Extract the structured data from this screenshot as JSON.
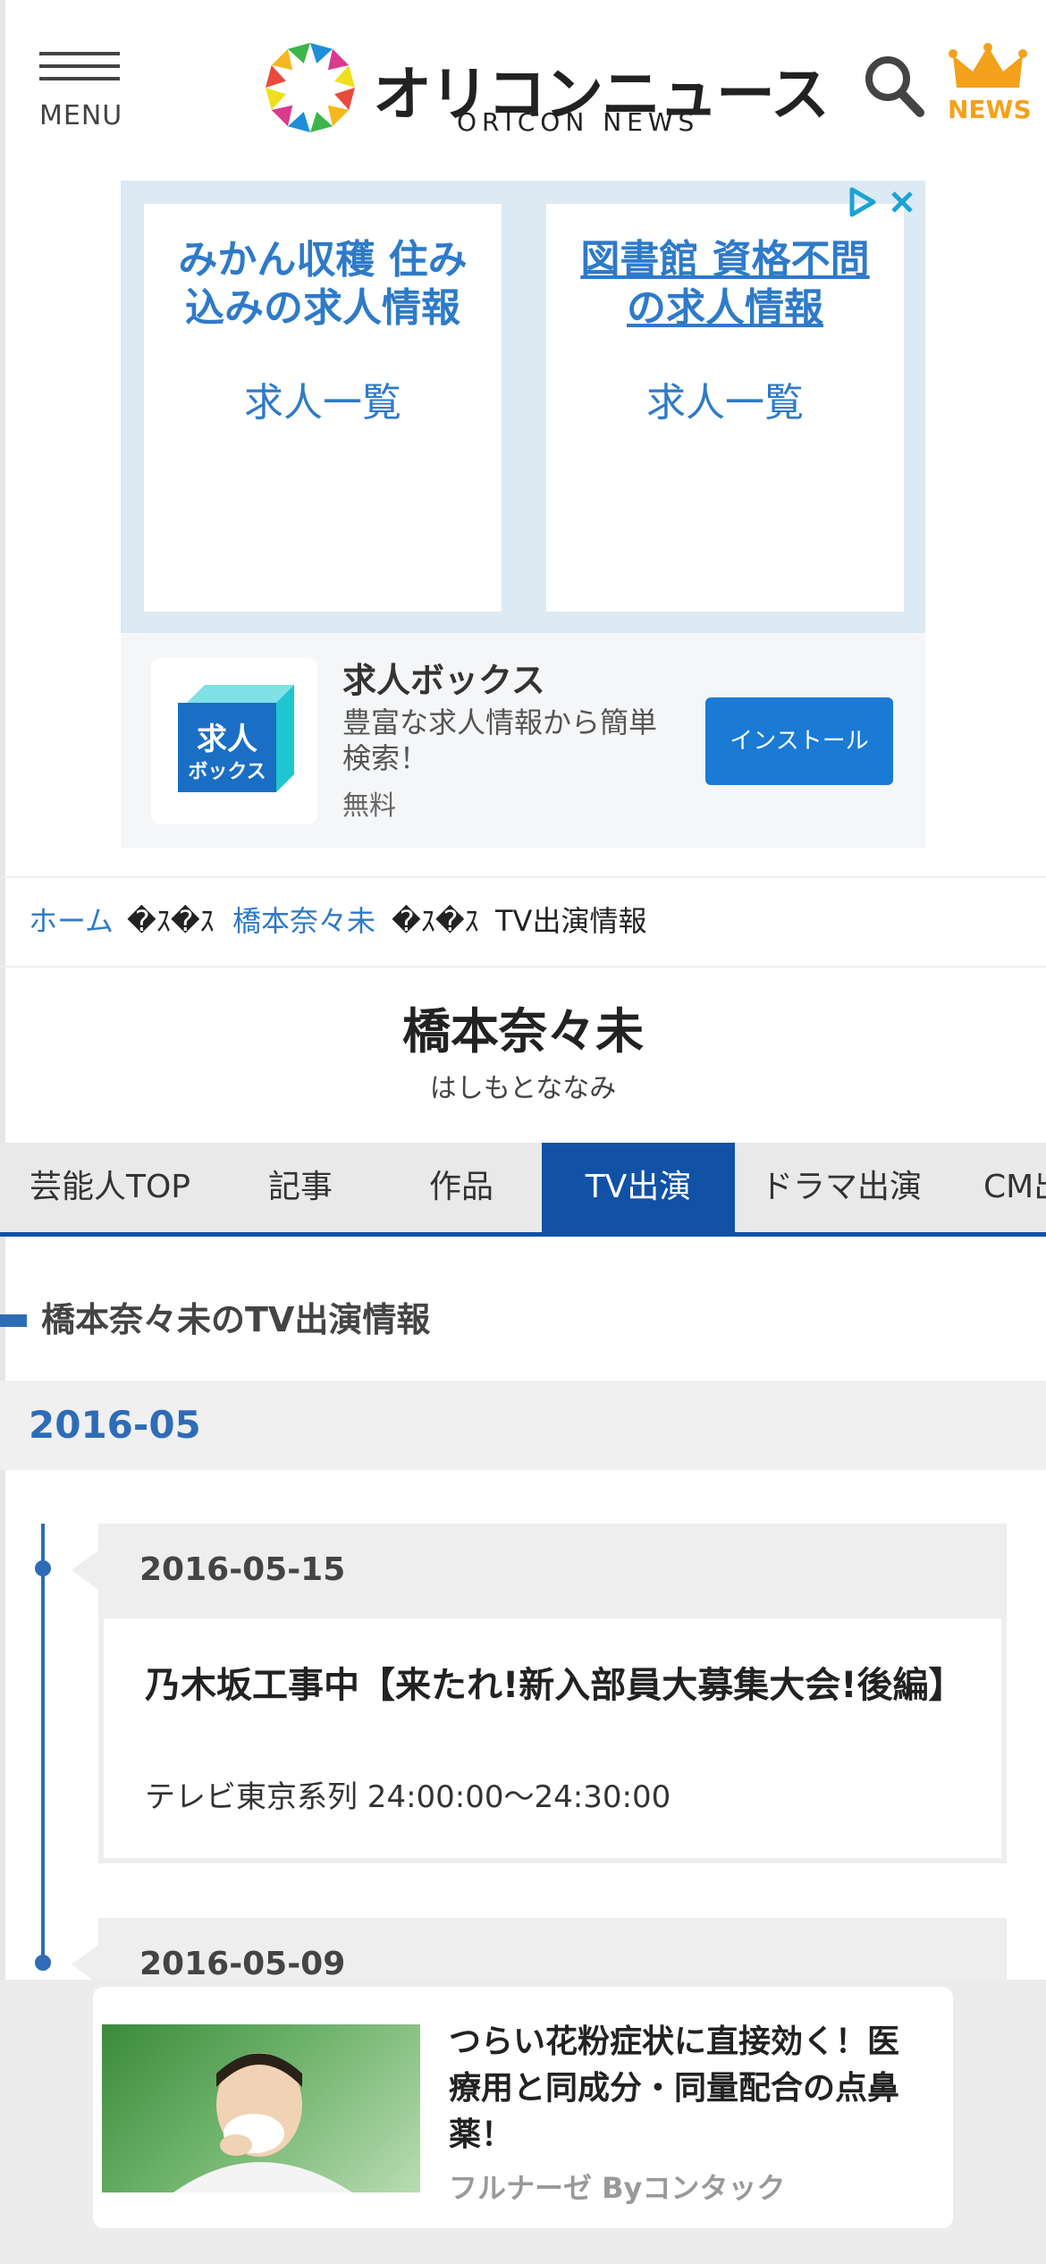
{
  "header": {
    "menu_label": "MENU",
    "logo_jp": "オリコンニュース",
    "logo_en": "ORICON NEWS",
    "news_label": "NEWS",
    "logo_colors": [
      "#e94a3c",
      "#f6b81e",
      "#3bb54a",
      "#1e8fd6",
      "#d93a8e",
      "#f0df1f"
    ]
  },
  "ad": {
    "card1_title": "みかん収穫 住み込みの求人情報",
    "card1_sub": "求人一覧",
    "card2_title": "図書館 資格不問の求人情報",
    "card2_sub": "求人一覧",
    "app_name": "求人ボックス",
    "app_desc": "豊富な求人情報から簡単検索！",
    "app_price": "無料",
    "install_label": "インストール",
    "app_icon_text_1": "求人",
    "app_icon_text_2": "ボックス"
  },
  "breadcrumb": {
    "home": "ホーム",
    "sep1": "�ｽ�ｽ",
    "talent": "橋本奈々未",
    "sep2": "�ｽ�ｽ",
    "current": "TV出演情報"
  },
  "talent": {
    "name": "橋本奈々未",
    "kana": "はしもとななみ"
  },
  "tabs": [
    {
      "label": "芸能人TOP",
      "active": false
    },
    {
      "label": "記事",
      "active": false
    },
    {
      "label": "作品",
      "active": false
    },
    {
      "label": "TV出演",
      "active": true
    },
    {
      "label": "ドラマ出演",
      "active": false
    },
    {
      "label": "CM出演",
      "active": false
    }
  ],
  "section": {
    "title": "橋本奈々未のTV出演情報",
    "month": "2016-05"
  },
  "entries": [
    {
      "date": "2016-05-15",
      "title": "乃木坂工事中【来たれ!新入部員大募集大会!後編】",
      "info": "テレビ東京系列 24:00:00〜24:30:00"
    },
    {
      "date": "2016-05-09"
    }
  ],
  "overlay_ad": {
    "title": "つらい花粉症状に直接効く！医療用と同成分・同量配合の点鼻薬！",
    "source": "フルナーゼ Byコンタック"
  }
}
